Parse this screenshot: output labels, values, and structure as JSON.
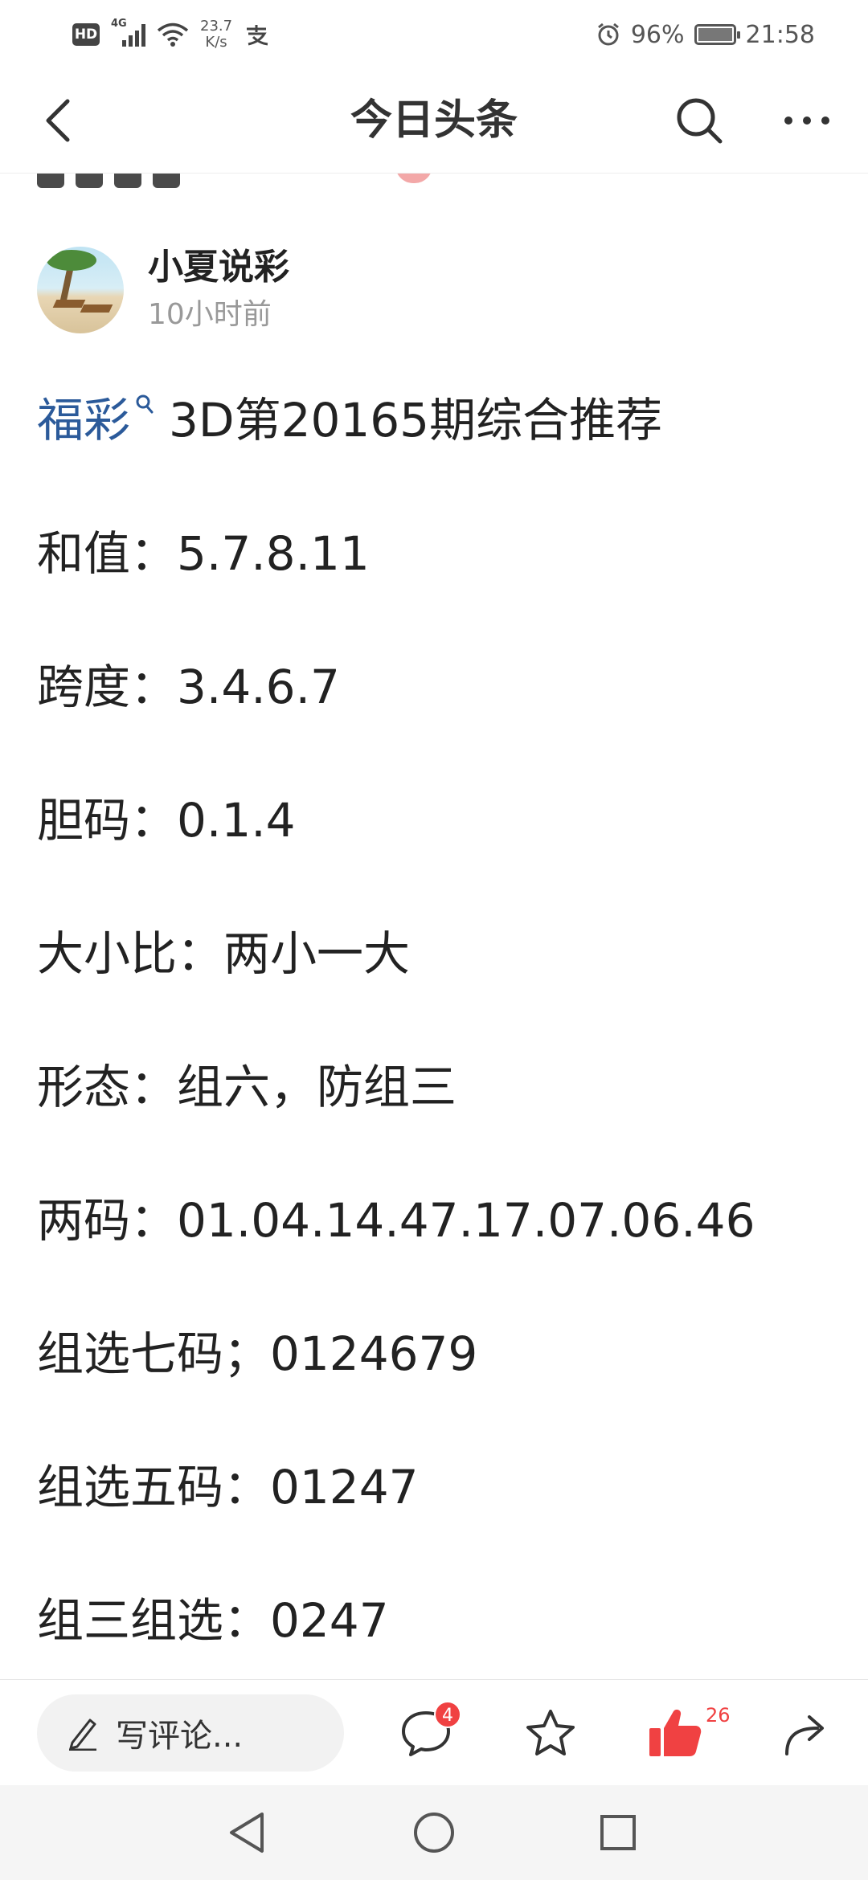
{
  "status_bar": {
    "hd": "HD",
    "network": "4G",
    "speed_value": "23.7",
    "speed_unit": "K/s",
    "alarm_icon": "alarm-icon",
    "battery_text": "96%",
    "battery_level": 0.96,
    "time": "21:58"
  },
  "nav": {
    "title": "今日头条",
    "back_icon": "back-arrow-icon",
    "search_icon": "search-icon",
    "more_icon": "more-icon"
  },
  "author": {
    "name": "小夏说彩",
    "time": "10小时前"
  },
  "article": {
    "headline_link": "福彩",
    "headline_rest": "3D第20165期综合推荐",
    "lines": [
      "和值：5.7.8.11",
      "跨度：3.4.6.7",
      "胆码：0.1.4",
      "大小比：两小一大",
      "形态：组六，防组三",
      "两码：01.04.14.47.17.07.06.46",
      "组选七码；0124679",
      "组选五码：01247",
      "组三组选：0247"
    ]
  },
  "action_bar": {
    "comment_placeholder": "写评论...",
    "comment_count": "4",
    "like_count": "26",
    "accent_color": "#f04142"
  }
}
